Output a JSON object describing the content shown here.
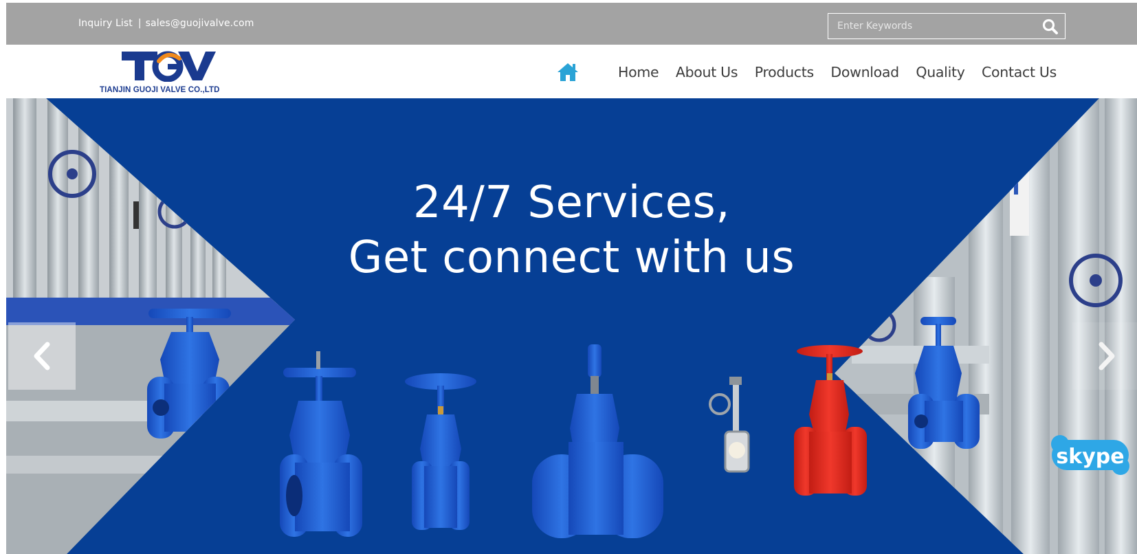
{
  "topbar": {
    "inquiry_label": "Inquiry List",
    "separator": "|",
    "email": "sales@guojivalve.com",
    "search_placeholder": "Enter Keywords"
  },
  "logo": {
    "mark_text": "TGV",
    "company_name": "TIANJIN GUOJI VALVE CO.,LTD"
  },
  "nav": {
    "items": [
      {
        "label": "Home"
      },
      {
        "label": "About Us"
      },
      {
        "label": "Products"
      },
      {
        "label": "Download"
      },
      {
        "label": "Quality"
      },
      {
        "label": "Contact Us"
      }
    ]
  },
  "banner": {
    "headline_line1": "24/7 Services,",
    "headline_line2": "Get connect with us",
    "background_color": "#063f95",
    "valve_blue": "#1f5fd0",
    "valve_red": "#e02a1f"
  },
  "widgets": {
    "skype_label": "skype"
  },
  "icons": {
    "search": "search-icon",
    "home": "home-icon",
    "prev": "chevron-left-icon",
    "next": "chevron-right-icon",
    "skype": "skype-icon"
  }
}
